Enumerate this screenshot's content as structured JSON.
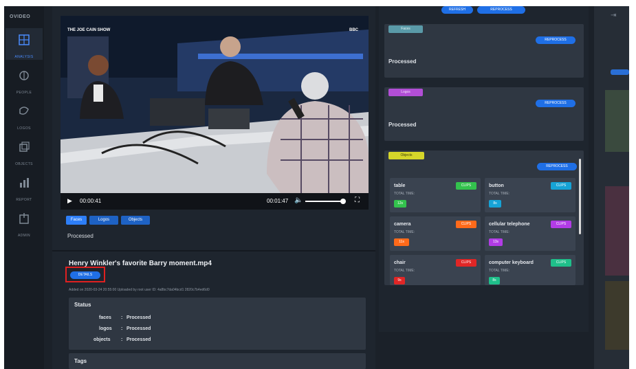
{
  "sidebar": {
    "logo": "OVIDEO",
    "items": [
      {
        "label": "ANALYSIS",
        "icon": "grid-icon",
        "active": true
      },
      {
        "label": "PEOPLE",
        "icon": "person-icon",
        "active": false
      },
      {
        "label": "LOGOS",
        "icon": "logo-icon",
        "active": false
      },
      {
        "label": "OBJECTS",
        "icon": "objects-icon",
        "active": false
      },
      {
        "label": "REPORT",
        "icon": "report-icon",
        "active": false
      },
      {
        "label": "ADMIN",
        "icon": "admin-icon",
        "active": false
      }
    ]
  },
  "player": {
    "show_logo": "THE JOE CAIN SHOW",
    "corner_logo": "BBC",
    "current_time": "00:00:41",
    "duration": "00:01:47",
    "progress": 0.38,
    "volume": 0.9
  },
  "tabs": [
    {
      "label": "Faces",
      "active": true
    },
    {
      "label": "Logos",
      "active": false
    },
    {
      "label": "Objects",
      "active": false
    }
  ],
  "processed_label": "Processed",
  "video": {
    "title": "Henry Winkler's favorite Barry moment.mp4",
    "details_button": "DETAILS",
    "meta": "Added on 2020-03-24 20:55:00   Uploaded by root user   ID: 4a8bc7da04bcd1 2820c7b4ed6d0"
  },
  "status": {
    "heading": "Status",
    "rows": [
      {
        "key": "faces",
        "value": "Processed"
      },
      {
        "key": "logos",
        "value": "Processed"
      },
      {
        "key": "objects",
        "value": "Processed"
      }
    ]
  },
  "tags_heading": "Tags",
  "right": {
    "top_buttons": [
      "REFRESH",
      "REPROCESS"
    ],
    "faces_badge": "Faces",
    "logos_badge": "Logos",
    "objects_badge": "Objects",
    "reprocess": "REPROCESS",
    "processed": "Processed",
    "objects": [
      {
        "name": "table",
        "sub": "TOTAL TIME:",
        "time": "12s",
        "time_color": "#33c24d",
        "clip_color": "#33c24d"
      },
      {
        "name": "button",
        "sub": "TOTAL TIME:",
        "time": "8s",
        "time_color": "#16a3d6",
        "clip_color": "#16a3d6"
      },
      {
        "name": "camera",
        "sub": "TOTAL TIME:",
        "time": "11s",
        "time_color": "#ff6a1a",
        "clip_color": "#ff6a1a"
      },
      {
        "name": "cellular telephone",
        "sub": "TOTAL TIME:",
        "time": "13s",
        "time_color": "#b23ce6",
        "clip_color": "#b23ce6"
      },
      {
        "name": "chair",
        "sub": "TOTAL TIME:",
        "time": "9s",
        "time_color": "#e02626",
        "clip_color": "#e02626"
      },
      {
        "name": "computer keyboard",
        "sub": "TOTAL TIME:",
        "time": "8s",
        "time_color": "#1fbf8a",
        "clip_color": "#1fbf8a"
      }
    ],
    "clips_label": "CLIPS"
  },
  "colors": {
    "accent": "#1f6fe6",
    "bg": "#1b2129",
    "panel": "#262d37",
    "card": "#2f3742"
  }
}
